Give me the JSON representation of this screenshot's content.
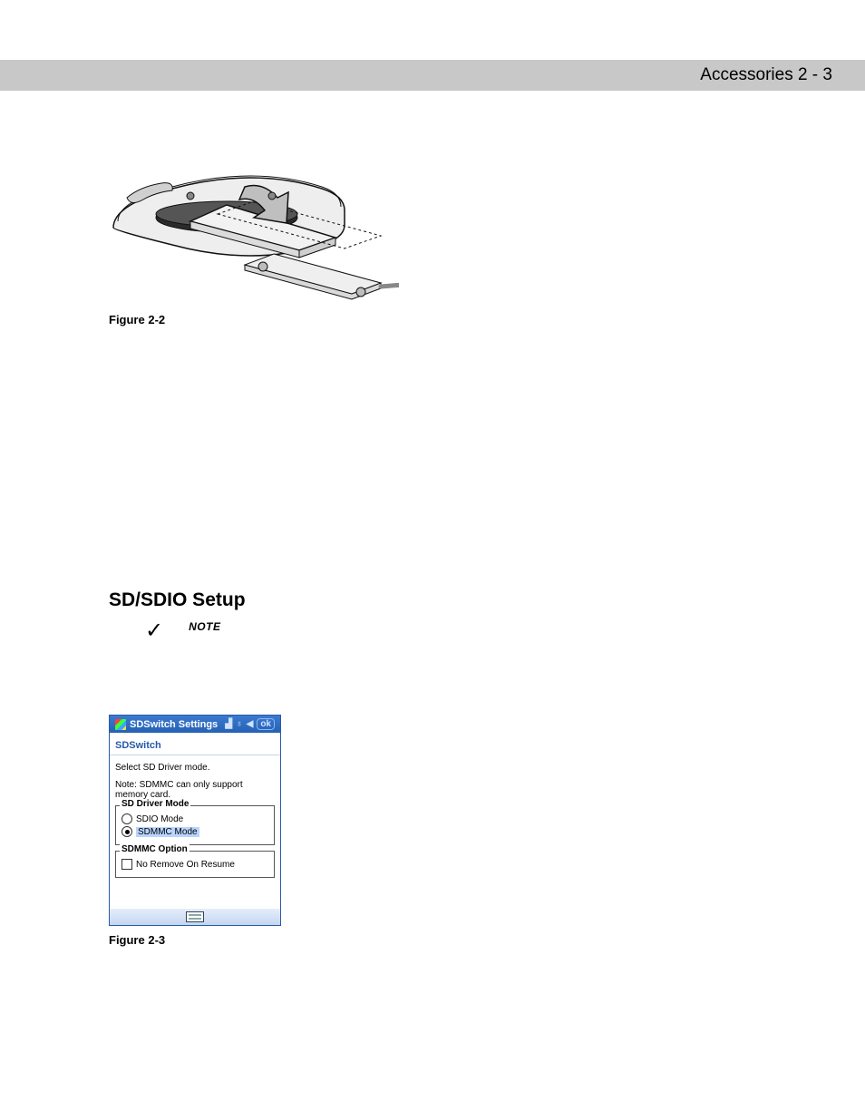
{
  "header": {
    "title": "Accessories 2 - 3"
  },
  "figure1": {
    "caption": "Figure 2-2"
  },
  "section": {
    "title": "SD/SDIO Setup"
  },
  "note": {
    "label": "NOTE"
  },
  "screen": {
    "title": "SDSwitch Settings",
    "ok": "ok",
    "tab": "SDSwitch",
    "line1": "Select SD Driver mode.",
    "line2": "Note: SDMMC can only support memory card.",
    "group1": {
      "legend": "SD Driver Mode",
      "opt1": "SDIO Mode",
      "opt2": "SDMMC Mode"
    },
    "group2": {
      "legend": "SDMMC Option",
      "chk": "No Remove On Resume"
    }
  },
  "figure2": {
    "caption": "Figure 2-3"
  }
}
